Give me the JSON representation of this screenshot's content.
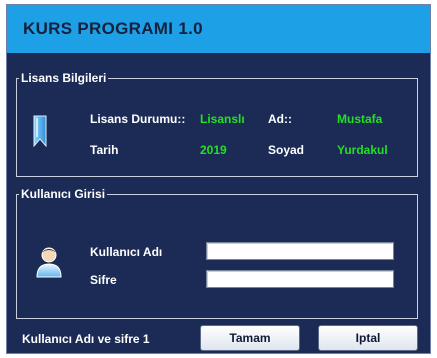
{
  "window": {
    "title": "KURS PROGRAMI 1.0"
  },
  "license": {
    "legend": "Lisans Bilgileri",
    "status_label": "Lisans Durumu::",
    "status_value": "Lisanslı",
    "name_label": "Ad::",
    "name_value": "Mustafa",
    "date_label": "Tarih",
    "date_value": "2019",
    "surname_label": "Soyad",
    "surname_value": "Yurdakul",
    "icon": "bookmark-icon"
  },
  "login": {
    "legend": "Kullanıcı Girisi",
    "username_label": "Kullanıcı Adı",
    "username_value": "",
    "password_label": "Sifre",
    "password_value": "",
    "icon": "user-icon"
  },
  "footer": {
    "status_text": "Kullanıcı Adı ve sifre 1",
    "ok_label": "Tamam",
    "cancel_label": "Iptal"
  },
  "colors": {
    "title_bar": "#1ea0e6",
    "window_bg": "#1c2b55",
    "value_green": "#22e022"
  }
}
